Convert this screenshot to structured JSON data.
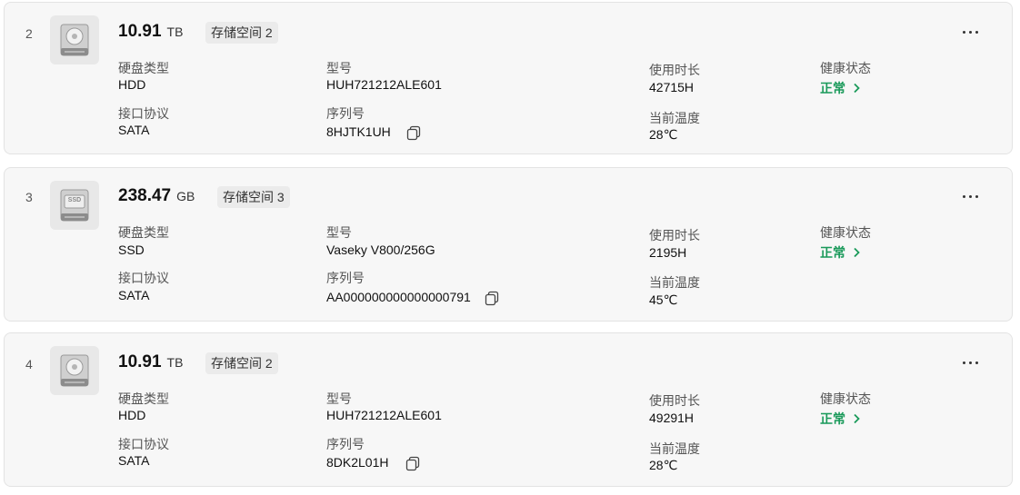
{
  "disks": [
    {
      "index": "2",
      "icon": "hdd-icon",
      "capacity": "10.91",
      "unit": "TB",
      "pool": "存储空间 2",
      "type_label": "硬盘类型",
      "type": "HDD",
      "model_label": "型号",
      "model": "HUH721212ALE601",
      "hours_label": "使用时长",
      "hours": "42715H",
      "health_label": "健康状态",
      "health": "正常",
      "iface_label": "接口协议",
      "iface": "SATA",
      "serial_label": "序列号",
      "serial": "8HJTK1UH",
      "temp_label": "当前温度",
      "temp": "28℃"
    },
    {
      "index": "3",
      "icon": "ssd-icon",
      "capacity": "238.47",
      "unit": "GB",
      "pool": "存储空间 3",
      "type_label": "硬盘类型",
      "type": "SSD",
      "model_label": "型号",
      "model": "Vaseky V800/256G",
      "hours_label": "使用时长",
      "hours": "2195H",
      "health_label": "健康状态",
      "health": "正常",
      "iface_label": "接口协议",
      "iface": "SATA",
      "serial_label": "序列号",
      "serial": "AA000000000000000791",
      "temp_label": "当前温度",
      "temp": "45℃",
      "ssd_badge": "SSD"
    },
    {
      "index": "4",
      "icon": "hdd-icon",
      "capacity": "10.91",
      "unit": "TB",
      "pool": "存储空间 2",
      "type_label": "硬盘类型",
      "type": "HDD",
      "model_label": "型号",
      "model": "HUH721212ALE601",
      "hours_label": "使用时长",
      "hours": "49291H",
      "health_label": "健康状态",
      "health": "正常",
      "iface_label": "接口协议",
      "iface": "SATA",
      "serial_label": "序列号",
      "serial": "8DK2L01H",
      "temp_label": "当前温度",
      "temp": "28℃"
    }
  ],
  "colors": {
    "health_ok": "#1a9a5a",
    "card_bg": "#f7f7f7"
  }
}
